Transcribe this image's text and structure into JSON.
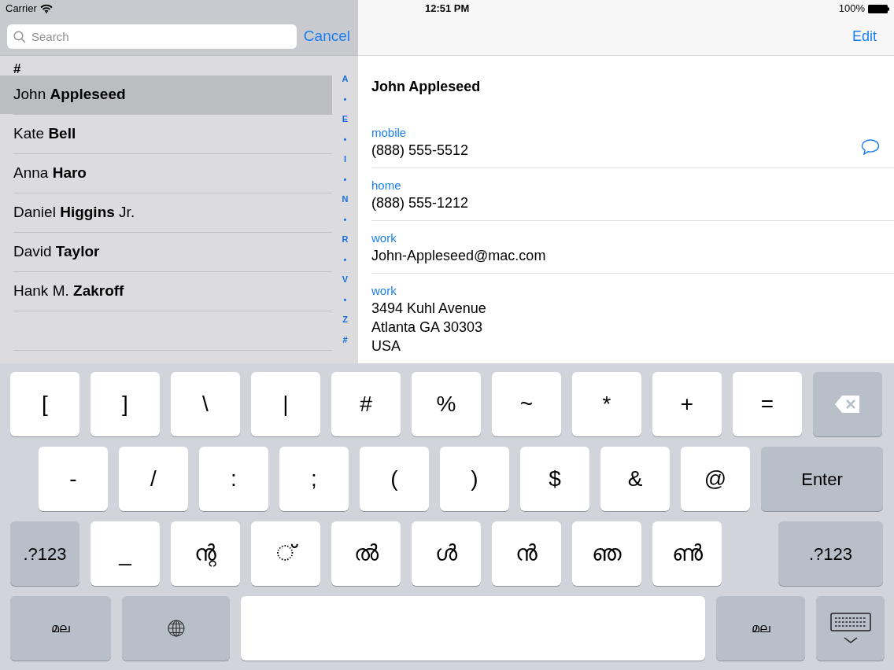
{
  "status_bar": {
    "carrier": "Carrier",
    "time": "12:51 PM",
    "battery": "100%"
  },
  "search": {
    "placeholder": "Search",
    "cancel": "Cancel"
  },
  "contacts": {
    "section_header": "#",
    "rows": [
      {
        "name": "John **Appleseed**",
        "selected": true
      },
      {
        "name": "Kate **Bell**",
        "selected": false
      },
      {
        "name": "Anna **Haro**",
        "selected": false
      },
      {
        "name": "Daniel **Higgins** Jr.",
        "selected": false
      },
      {
        "name": "David **Taylor**",
        "selected": false
      },
      {
        "name": "Hank M. **Zakroff**",
        "selected": false
      }
    ]
  },
  "index": [
    "A",
    "•",
    "E",
    "•",
    "I",
    "•",
    "N",
    "•",
    "R",
    "•",
    "V",
    "•",
    "Z",
    "#"
  ],
  "detail": {
    "edit": "Edit",
    "name": "John Appleseed",
    "fields": [
      {
        "label": "mobile",
        "lines": [
          "(888) 555-5512"
        ],
        "message": true
      },
      {
        "label": "home",
        "lines": [
          "(888) 555-1212"
        ],
        "message": false
      },
      {
        "label": "work",
        "lines": [
          "John-Appleseed@mac.com"
        ],
        "message": false
      },
      {
        "label": "work",
        "lines": [
          "3494 Kuhl Avenue",
          "Atlanta GA 30303",
          "USA"
        ],
        "message": false
      }
    ]
  },
  "keyboard": {
    "rows": [
      [
        {
          "kind": "char",
          "label": "["
        },
        {
          "kind": "char",
          "label": "]"
        },
        {
          "kind": "char",
          "label": "\\"
        },
        {
          "kind": "char",
          "label": "|"
        },
        {
          "kind": "char",
          "label": "#"
        },
        {
          "kind": "char",
          "label": "%"
        },
        {
          "kind": "char",
          "label": "~"
        },
        {
          "kind": "char",
          "label": "*"
        },
        {
          "kind": "char",
          "label": "+"
        },
        {
          "kind": "char",
          "label": "="
        },
        {
          "kind": "delete"
        }
      ],
      [
        {
          "kind": "char",
          "label": "-"
        },
        {
          "kind": "char",
          "label": "/"
        },
        {
          "kind": "char",
          "label": ":"
        },
        {
          "kind": "char",
          "label": ";"
        },
        {
          "kind": "char",
          "label": "("
        },
        {
          "kind": "char",
          "label": ")"
        },
        {
          "kind": "char",
          "label": "$"
        },
        {
          "kind": "char",
          "label": "&"
        },
        {
          "kind": "char",
          "label": "@"
        },
        {
          "kind": "enter",
          "label": "Enter"
        }
      ],
      [
        {
          "kind": "mode",
          "label": ".?123"
        },
        {
          "kind": "char",
          "label": "_"
        },
        {
          "kind": "char",
          "label": "ന്റ"
        },
        {
          "kind": "char",
          "label": "്"
        },
        {
          "kind": "char",
          "label": "ൽ"
        },
        {
          "kind": "char",
          "label": "ൾ"
        },
        {
          "kind": "char",
          "label": "ൻ"
        },
        {
          "kind": "char",
          "label": "ഞ"
        },
        {
          "kind": "char",
          "label": "ൺ"
        },
        {
          "kind": "mode-right",
          "label": ".?123"
        }
      ],
      [
        {
          "kind": "lang",
          "label": "മല"
        },
        {
          "kind": "globe"
        },
        {
          "kind": "space"
        },
        {
          "kind": "lang-right",
          "label": "മല"
        },
        {
          "kind": "hide"
        }
      ]
    ]
  }
}
